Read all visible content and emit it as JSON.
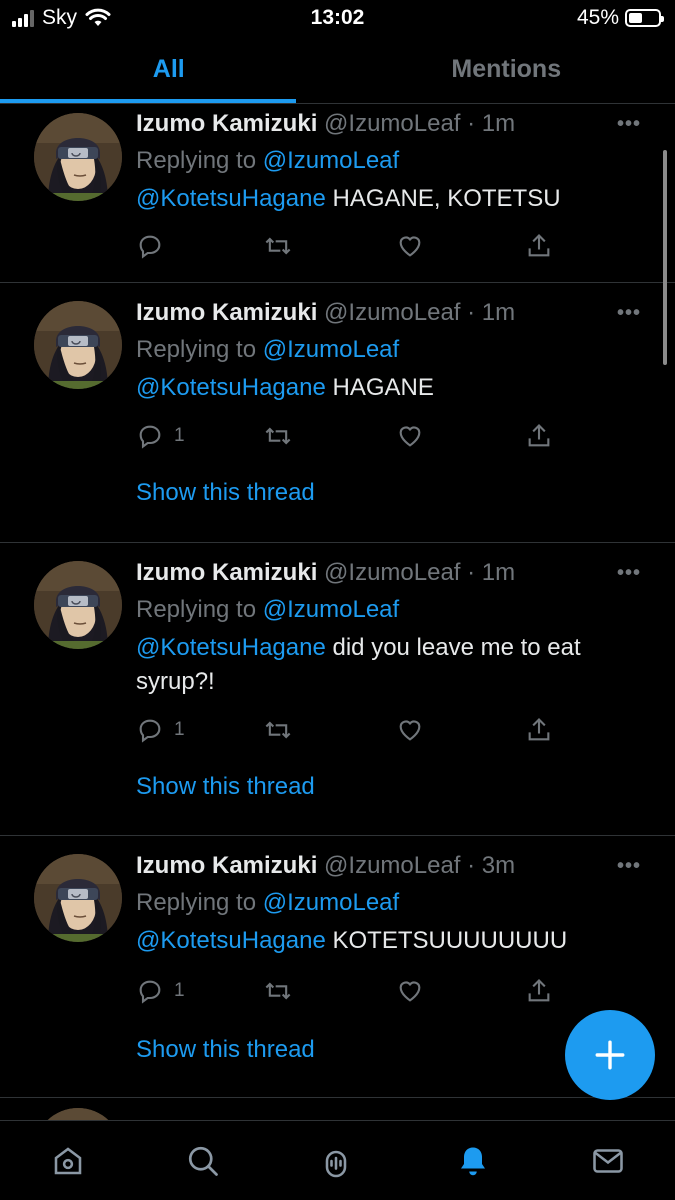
{
  "status_bar": {
    "carrier": "Sky",
    "time": "13:02",
    "battery_text": "45%",
    "battery_level": 0.45
  },
  "tabs": [
    {
      "label": "All",
      "active": true
    },
    {
      "label": "Mentions",
      "active": false
    }
  ],
  "tweets": [
    {
      "name": "Izumo Kamizuki",
      "handle": "@IzumoLeaf",
      "time": "1m",
      "replying_prefix": "Replying to",
      "replying_to": "@IzumoLeaf",
      "mention": "@KotetsuHagane",
      "text": " HAGANE, KOTETSU",
      "reply_count": "",
      "show_thread": ""
    },
    {
      "name": "Izumo Kamizuki",
      "handle": "@IzumoLeaf",
      "time": "1m",
      "replying_prefix": "Replying to",
      "replying_to": "@IzumoLeaf",
      "mention": "@KotetsuHagane",
      "text": " HAGANE",
      "reply_count": "1",
      "show_thread": "Show this thread"
    },
    {
      "name": "Izumo Kamizuki",
      "handle": "@IzumoLeaf",
      "time": "1m",
      "replying_prefix": "Replying to",
      "replying_to": "@IzumoLeaf",
      "mention": "@KotetsuHagane",
      "text": " did you leave me to eat syrup?!",
      "reply_count": "1",
      "show_thread": "Show this thread"
    },
    {
      "name": "Izumo Kamizuki",
      "handle": "@IzumoLeaf",
      "time": "3m",
      "replying_prefix": "Replying to",
      "replying_to": "@IzumoLeaf",
      "mention": "@KotetsuHagane",
      "text": " KOTETSUUUUUUUU",
      "reply_count": "1",
      "show_thread": "Show this thread"
    }
  ],
  "icons": {
    "reply": "reply-icon",
    "retweet": "retweet-icon",
    "like": "heart-icon",
    "share": "share-icon",
    "more": "more-options-icon",
    "compose": "plus-icon",
    "nav": [
      "home-icon",
      "search-icon",
      "spaces-icon",
      "notifications-icon",
      "messages-icon"
    ]
  },
  "colors": {
    "accent": "#1d9bf0",
    "background": "#000000",
    "muted": "#71767b"
  }
}
